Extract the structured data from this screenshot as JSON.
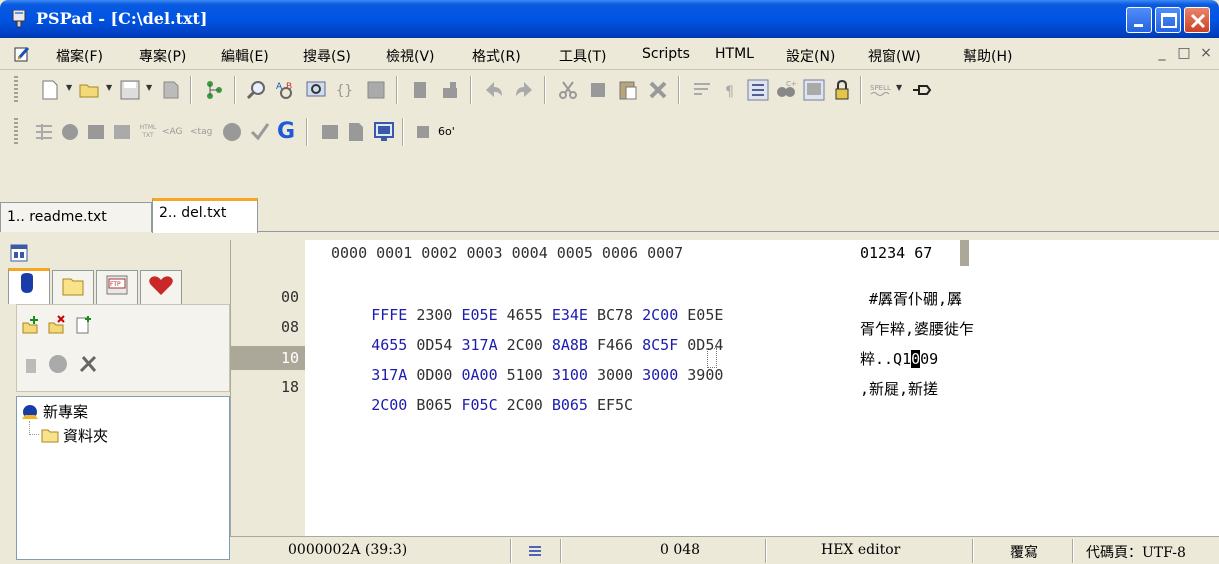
{
  "window": {
    "title": "PSPad - [C:\\del.txt]",
    "controls": {
      "minimize": "minimize",
      "maximize": "maximize",
      "close": "close"
    }
  },
  "menu": {
    "items": [
      "檔案(F)",
      "專案(P)",
      "編輯(E)",
      "搜尋(S)",
      "檢視(V)",
      "格式(R)",
      "工具(T)",
      "Scripts",
      "HTML",
      "設定(N)",
      "視窗(W)",
      "幫助(H)"
    ],
    "right_controls": [
      "_",
      "□",
      "×"
    ]
  },
  "toolbar2": {
    "html_label_top": "HTML",
    "html_label_bottom": "TXT",
    "tag_upper": "<AG",
    "tag_lower": "<tag",
    "g_letter": "G",
    "glasses": "6o'"
  },
  "toolbar1": {
    "spell": "SPELL"
  },
  "doc_tabs": [
    {
      "label": "1.. readme.txt",
      "active": false
    },
    {
      "label": "2.. del.txt",
      "active": true
    }
  ],
  "project_tabs": [
    "sphere",
    "folder",
    "FTP",
    "heart"
  ],
  "project_tree": {
    "root": "新專案",
    "child": "資料夾"
  },
  "hex": {
    "header_cols": "0000 0001 0002 0003 0004 0005 0006 0007",
    "header_text_a": "01234",
    "header_text_hl": "5",
    "header_text_b": "67",
    "rows": [
      {
        "offset": "00",
        "words": [
          "FFFE",
          "2300",
          "E05E",
          "4655",
          "E34E",
          "BC78",
          "2C00",
          "E05E"
        ],
        "text": " #羼胥仆硼,羼"
      },
      {
        "offset": "08",
        "words": [
          "4655",
          "0D54",
          "317A",
          "2C00",
          "8A8B",
          "F466",
          "8C5F",
          "0D54"
        ],
        "text": "胥乍粹,婆腰徙乍"
      },
      {
        "offset": "10",
        "words": [
          "317A",
          "0D00",
          "0A00",
          "5100",
          "3100",
          "3000",
          "3000",
          "3900"
        ],
        "text_a": "粹..Q1",
        "text_cursor": "0",
        "text_b": "09"
      },
      {
        "offset": "18",
        "words": [
          "2C00",
          "B065",
          "F05C",
          "2C00",
          "B065",
          "EF5C"
        ],
        "text": ",新屣,新搓"
      }
    ]
  },
  "status": {
    "position": "0000002A  (39:3)",
    "value": "0 048",
    "mode": "HEX editor",
    "overwrite": "覆寫",
    "codepage": "代碼頁：UTF-8"
  }
}
